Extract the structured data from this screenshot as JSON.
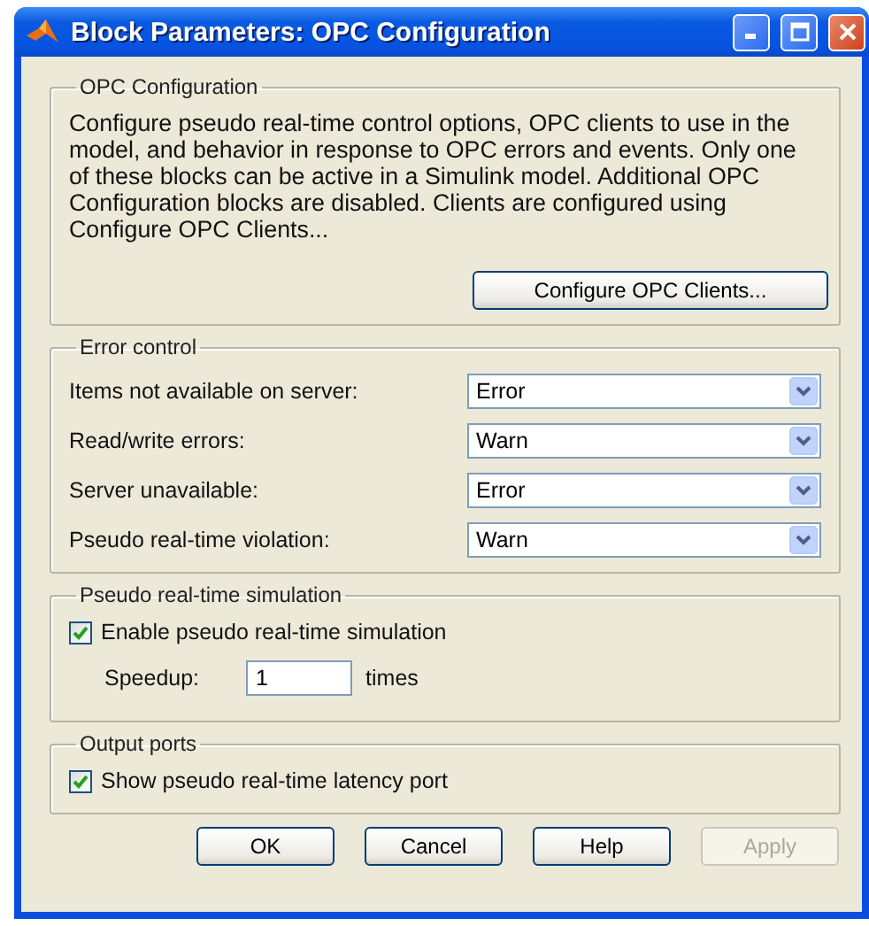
{
  "window": {
    "title": "Block Parameters: OPC Configuration"
  },
  "opc_configuration": {
    "title": "OPC Configuration",
    "description": "Configure pseudo real-time control options, OPC clients to use in the model, and behavior in response to OPC errors and events. Only one of these blocks can be active in a Simulink model. Additional OPC Configuration blocks are disabled. Clients are configured using Configure OPC Clients...",
    "button": "Configure OPC Clients..."
  },
  "error_control": {
    "title": "Error control",
    "rows": [
      {
        "label": "Items not available on server:",
        "value": "Error"
      },
      {
        "label": "Read/write errors:",
        "value": "Warn"
      },
      {
        "label": "Server unavailable:",
        "value": "Error"
      },
      {
        "label": "Pseudo real-time violation:",
        "value": "Warn"
      }
    ]
  },
  "pseudo_real_time_simulation": {
    "title": "Pseudo real-time simulation",
    "enable": {
      "label": "Enable pseudo real-time simulation",
      "checked": true
    },
    "speedup": {
      "label": "Speedup:",
      "value": "1",
      "unit": "times"
    }
  },
  "output_ports": {
    "title": "Output ports",
    "latency_port": {
      "label": "Show pseudo real-time latency port",
      "checked": true
    }
  },
  "buttons": [
    {
      "label": "OK",
      "disabled": false
    },
    {
      "label": "Cancel",
      "disabled": false
    },
    {
      "label": "Help",
      "disabled": false
    },
    {
      "label": "Apply",
      "disabled": true
    }
  ]
}
